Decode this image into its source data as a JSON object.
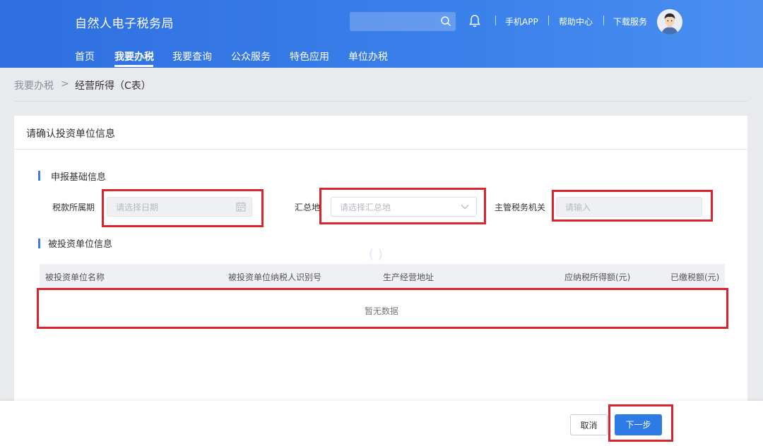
{
  "header": {
    "title": "自然人电子税务局",
    "search_placeholder": "",
    "links": [
      "手机APP",
      "帮助中心",
      "下载服务"
    ]
  },
  "nav": [
    "首页",
    "我要办税",
    "我要查询",
    "公众服务",
    "特色应用",
    "单位办税"
  ],
  "nav_active": "我要办税",
  "breadcrumb": {
    "parent": "我要办税",
    "arrow": ">",
    "current": "经营所得（C表）"
  },
  "card": {
    "title": "请确认投资单位信息",
    "section1": {
      "title": "申报基础信息",
      "period_label": "税款所属期",
      "period_placeholder": "请选择日期",
      "region_label": "汇总地",
      "region_placeholder": "请选择汇总地",
      "authority_label": "主管税务机关",
      "authority_placeholder": "请输入"
    },
    "section2": {
      "title": "被投资单位信息",
      "columns": [
        "被投资单位名称",
        "被投资单位纳税人识别号",
        "生产经营地址",
        "应纳税所得额(元)",
        "已缴税额(元)"
      ],
      "empty": "暂无数据"
    }
  },
  "footer": {
    "cancel": "取消",
    "next": "下一步"
  },
  "colors": {
    "primary": "#2f7be6",
    "highlight": "#d9262e"
  }
}
